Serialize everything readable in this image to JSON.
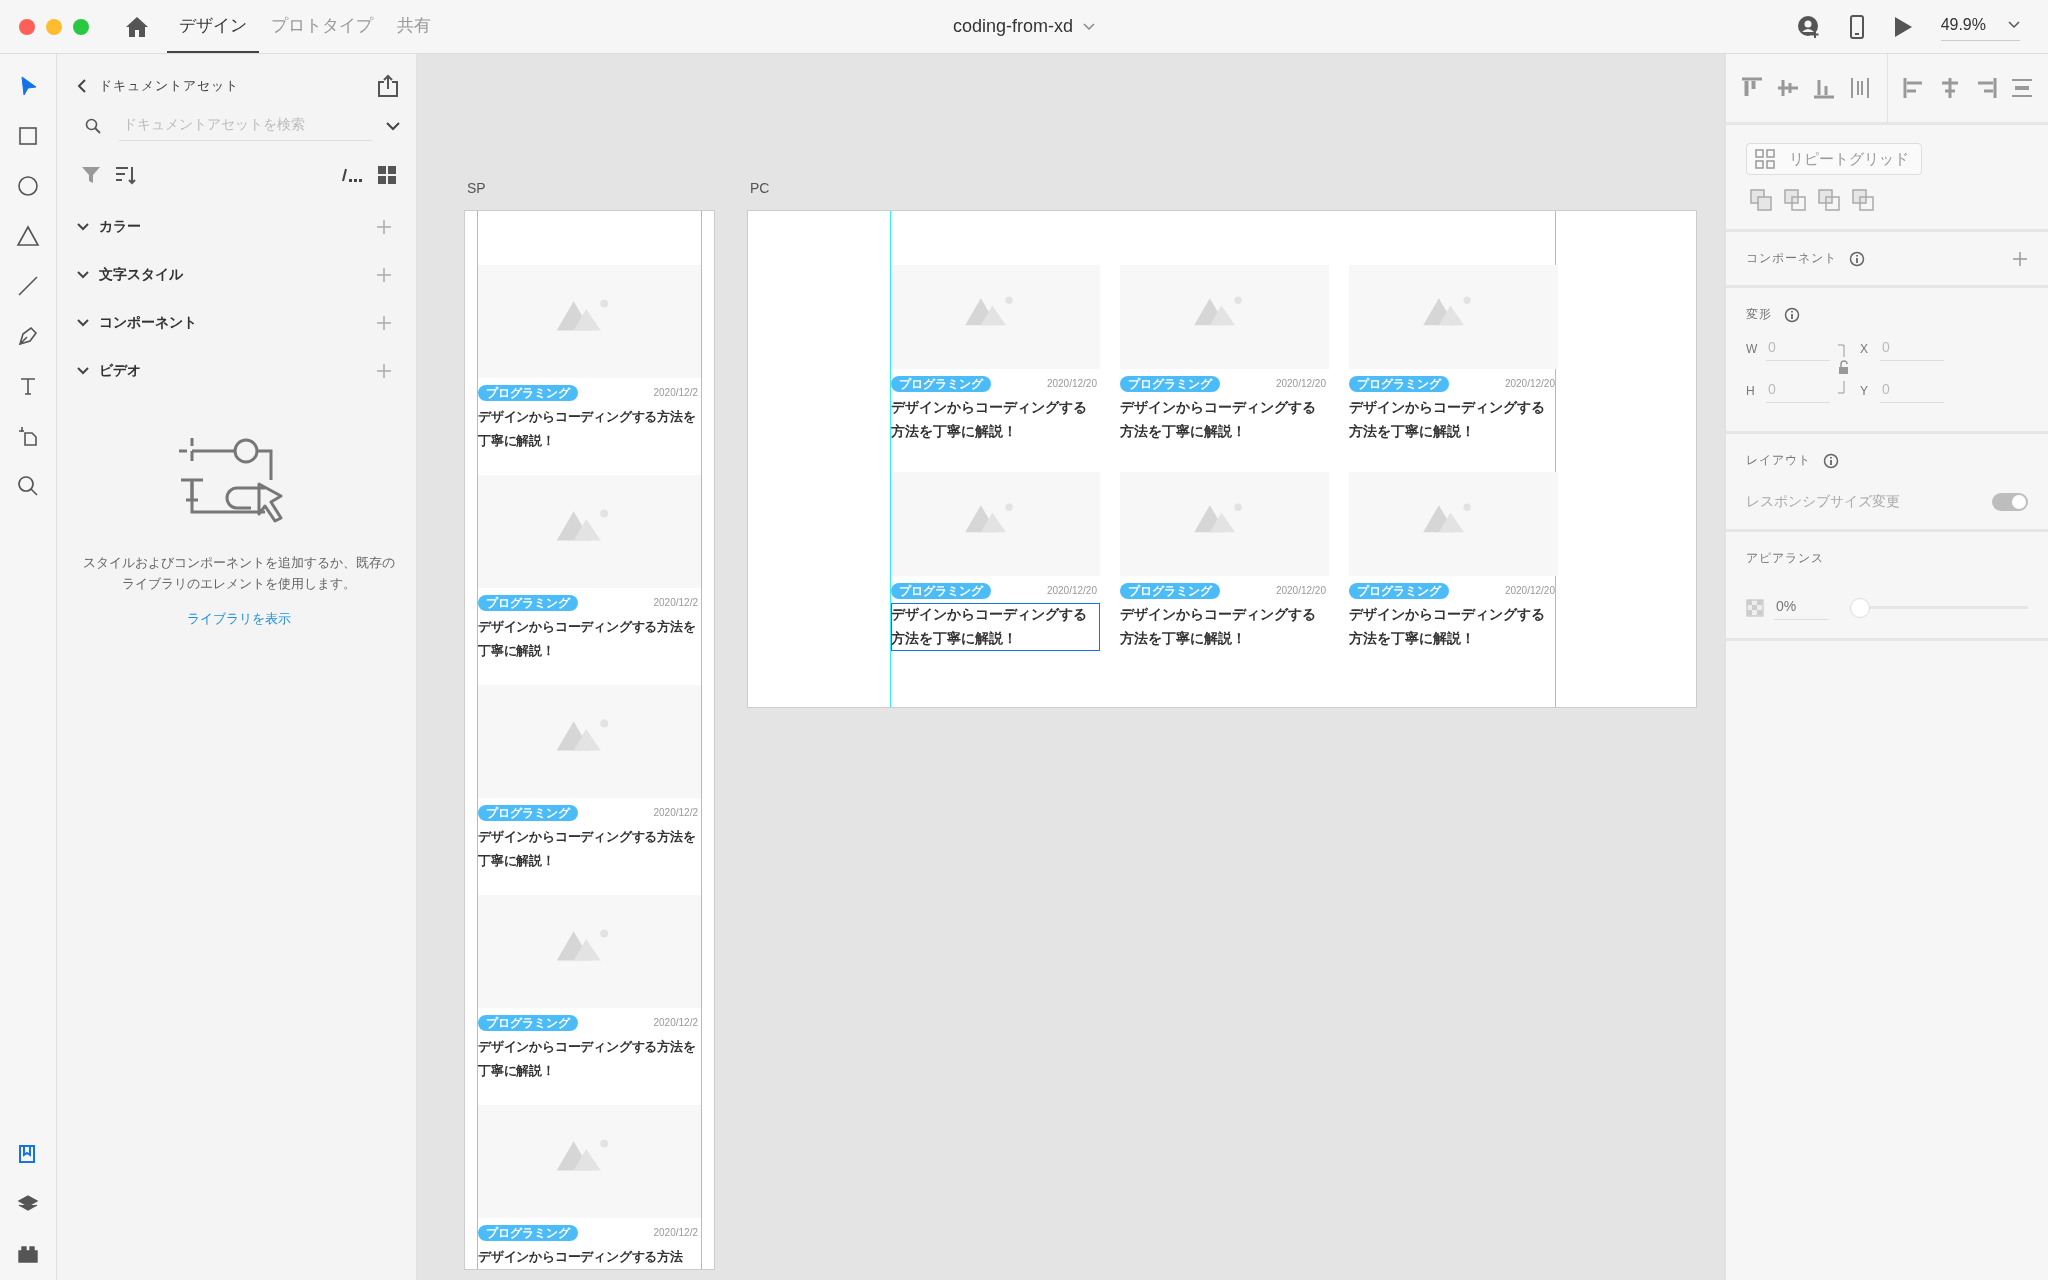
{
  "window": {
    "tabs": [
      {
        "label": "デザイン",
        "selected": true
      },
      {
        "label": "プロトタイプ",
        "selected": false
      },
      {
        "label": "共有",
        "selected": false
      }
    ],
    "title": "coding-from-xd",
    "zoom": "49.9%"
  },
  "tools": [
    {
      "kind": "select",
      "selected": true
    },
    {
      "kind": "rectangle",
      "selected": false
    },
    {
      "kind": "ellipse",
      "selected": false
    },
    {
      "kind": "polygon",
      "selected": false
    },
    {
      "kind": "line",
      "selected": false
    },
    {
      "kind": "pen",
      "selected": false
    },
    {
      "kind": "text",
      "selected": false
    },
    {
      "kind": "artboard",
      "selected": false
    },
    {
      "kind": "zoom",
      "selected": false
    }
  ],
  "bottom_tools": [
    {
      "kind": "assets",
      "selected": true
    },
    {
      "kind": "layers",
      "selected": false
    },
    {
      "kind": "plugins",
      "selected": false
    }
  ],
  "assets_panel": {
    "title": "ドキュメントアセット",
    "search_placeholder": "ドキュメントアセットを検索",
    "sections": [
      {
        "label": "カラー",
        "expanded": true
      },
      {
        "label": "文字スタイル",
        "expanded": true
      },
      {
        "label": "コンポーネント",
        "expanded": true
      },
      {
        "label": "ビデオ",
        "expanded": true
      }
    ],
    "empty_message": "スタイルおよびコンポーネントを追加するか、既存のライブラリのエレメントを使用します。",
    "link": "ライブラリを表示"
  },
  "artboards": [
    {
      "label": "SP",
      "cards": [
        {
          "tag": "プログラミング",
          "date": "2020/12/2",
          "title": "デザインからコーディングする方法を丁寧に解説！",
          "selected": false
        },
        {
          "tag": "プログラミング",
          "date": "2020/12/2",
          "title": "デザインからコーディングする方法を丁寧に解説！",
          "selected": false
        },
        {
          "tag": "プログラミング",
          "date": "2020/12/2",
          "title": "デザインからコーディングする方法を丁寧に解説！",
          "selected": false
        },
        {
          "tag": "プログラミング",
          "date": "2020/12/2",
          "title": "デザインからコーディングする方法を丁寧に解説！",
          "selected": false
        },
        {
          "tag": "プログラミング",
          "date": "2020/12/2",
          "title": "デザインからコーディングする方法",
          "selected": false
        }
      ]
    },
    {
      "label": "PC",
      "cards": [
        {
          "tag": "プログラミング",
          "date": "2020/12/20",
          "title": "デザインからコーディングする方法を丁寧に解説！",
          "selected": false
        },
        {
          "tag": "プログラミング",
          "date": "2020/12/20",
          "title": "デザインからコーディングする方法を丁寧に解説！",
          "selected": false
        },
        {
          "tag": "プログラミング",
          "date": "2020/12/20",
          "title": "デザインからコーディングする方法を丁寧に解説！",
          "selected": false
        },
        {
          "tag": "プログラミング",
          "date": "2020/12/20",
          "title": "デザインからコーディングする方法を丁寧に解説！",
          "selected": true
        },
        {
          "tag": "プログラミング",
          "date": "2020/12/20",
          "title": "デザインからコーディングする方法を丁寧に解説！",
          "selected": false
        },
        {
          "tag": "プログラミング",
          "date": "2020/12/20",
          "title": "デザインからコーディングする方法を丁寧に解説！",
          "selected": false
        }
      ]
    }
  ],
  "properties": {
    "repeat_grid": "リピートグリッド",
    "component": "コンポーネント",
    "transform": "変形",
    "fields": [
      {
        "label": "W",
        "placeholder": "0"
      },
      {
        "label": "X",
        "placeholder": "0"
      },
      {
        "label": "H",
        "placeholder": "0"
      },
      {
        "label": "Y",
        "placeholder": "0"
      }
    ],
    "layout": "レイアウト",
    "responsive": {
      "label": "レスポンシブサイズ変更",
      "on": true
    },
    "appearance": "アピアランス",
    "opacity": {
      "value": "0%",
      "level": 0
    }
  }
}
